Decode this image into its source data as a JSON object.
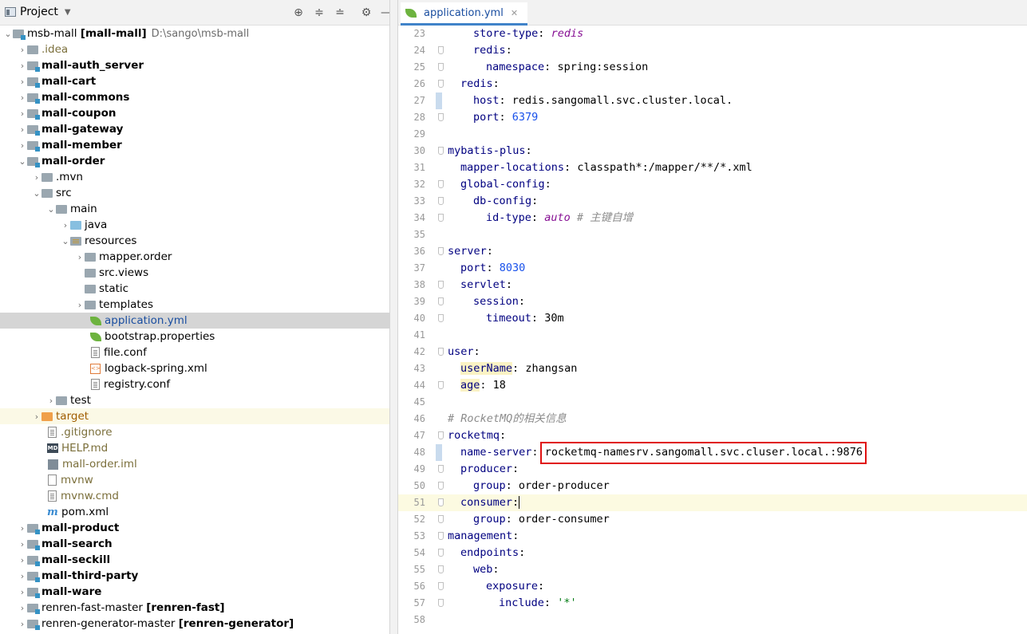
{
  "project": {
    "title": "Project",
    "tree": [
      {
        "label": "msb-mall",
        "bold": "[mall-mall]",
        "path": "D:\\sango\\msb-mall"
      },
      {
        "label": ".idea"
      },
      {
        "label": "mall-auth_server"
      },
      {
        "label": "mall-cart"
      },
      {
        "label": "mall-commons"
      },
      {
        "label": "mall-coupon"
      },
      {
        "label": "mall-gateway"
      },
      {
        "label": "mall-member"
      },
      {
        "label": "mall-order"
      },
      {
        "label": ".mvn"
      },
      {
        "label": "src"
      },
      {
        "label": "main"
      },
      {
        "label": "java"
      },
      {
        "label": "resources"
      },
      {
        "label": "mapper.order"
      },
      {
        "label": "src.views"
      },
      {
        "label": "static"
      },
      {
        "label": "templates"
      },
      {
        "label": "application.yml"
      },
      {
        "label": "bootstrap.properties"
      },
      {
        "label": "file.conf"
      },
      {
        "label": "logback-spring.xml"
      },
      {
        "label": "registry.conf"
      },
      {
        "label": "test"
      },
      {
        "label": "target"
      },
      {
        "label": ".gitignore"
      },
      {
        "label": "HELP.md"
      },
      {
        "label": "mall-order.iml"
      },
      {
        "label": "mvnw"
      },
      {
        "label": "mvnw.cmd"
      },
      {
        "label": "pom.xml"
      },
      {
        "label": "mall-product"
      },
      {
        "label": "mall-search"
      },
      {
        "label": "mall-seckill"
      },
      {
        "label": "mall-third-party"
      },
      {
        "label": "mall-ware"
      },
      {
        "label": "renren-fast-master",
        "bold": "[renren-fast]"
      },
      {
        "label": "renren-generator-master",
        "bold": "[renren-generator]"
      }
    ]
  },
  "editor": {
    "tab": "application.yml",
    "lines": [
      {
        "n": "23",
        "key": "store-type",
        "val": "redis",
        "vtype": "it"
      },
      {
        "n": "24",
        "key": "redis",
        "val": ""
      },
      {
        "n": "25",
        "key": "namespace",
        "val": "spring:session"
      },
      {
        "n": "26",
        "key": "redis",
        "val": ""
      },
      {
        "n": "27",
        "key": "host",
        "val": "redis.sangomall.svc.cluster.local."
      },
      {
        "n": "28",
        "key": "port",
        "val": "6379",
        "vtype": "num"
      },
      {
        "n": "29"
      },
      {
        "n": "30",
        "key": "mybatis-plus",
        "val": ""
      },
      {
        "n": "31",
        "key": "mapper-locations",
        "val": "classpath*:/mapper/**/*.xml"
      },
      {
        "n": "32",
        "key": "global-config",
        "val": ""
      },
      {
        "n": "33",
        "key": "db-config",
        "val": ""
      },
      {
        "n": "34",
        "key": "id-type",
        "val": "auto",
        "vtype": "it",
        "comment": "# 主键自增"
      },
      {
        "n": "35"
      },
      {
        "n": "36",
        "key": "server",
        "val": ""
      },
      {
        "n": "37",
        "key": "port",
        "val": "8030",
        "vtype": "num"
      },
      {
        "n": "38",
        "key": "servlet",
        "val": ""
      },
      {
        "n": "39",
        "key": "session",
        "val": ""
      },
      {
        "n": "40",
        "key": "timeout",
        "val": "30m"
      },
      {
        "n": "41"
      },
      {
        "n": "42",
        "key": "user",
        "val": ""
      },
      {
        "n": "43",
        "key": "userName",
        "val": "zhangsan"
      },
      {
        "n": "44",
        "key": "age",
        "val": "18"
      },
      {
        "n": "45"
      },
      {
        "n": "46",
        "comment": "# RocketMQ的相关信息"
      },
      {
        "n": "47",
        "key": "rocketmq",
        "val": ""
      },
      {
        "n": "48",
        "key": "name-server",
        "val": "rocketmq-namesrv.sangomall.svc.cluser.local.:9876"
      },
      {
        "n": "49",
        "key": "producer",
        "val": ""
      },
      {
        "n": "50",
        "key": "group",
        "val": "order-producer"
      },
      {
        "n": "51",
        "key": "consumer",
        "val": ""
      },
      {
        "n": "52",
        "key": "group",
        "val": "order-consumer"
      },
      {
        "n": "53",
        "key": "management",
        "val": ""
      },
      {
        "n": "54",
        "key": "endpoints",
        "val": ""
      },
      {
        "n": "55",
        "key": "web",
        "val": ""
      },
      {
        "n": "56",
        "key": "exposure",
        "val": ""
      },
      {
        "n": "57",
        "key": "include",
        "val": "'*'",
        "vtype": "str"
      },
      {
        "n": "58"
      }
    ]
  },
  "colors": {
    "selection": "#d5d5d5",
    "highlight_box": "#e01010",
    "accent": "#4083c9"
  }
}
